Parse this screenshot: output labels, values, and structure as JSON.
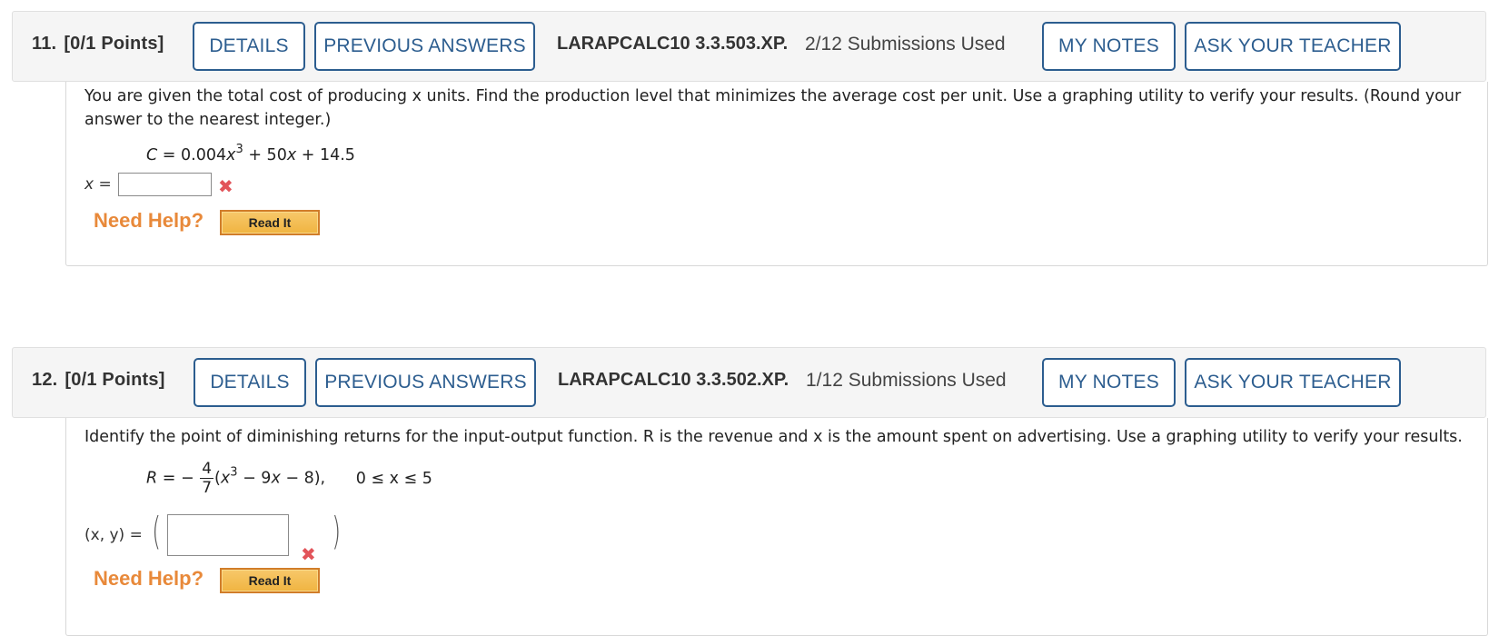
{
  "questions": [
    {
      "number": "11.",
      "points": "[0/1 Points]",
      "details_label": "DETAILS",
      "previous_answers_label": "PREVIOUS ANSWERS",
      "code": "LARAPCALC10 3.3.503.XP.",
      "submissions": "2/12 Submissions Used",
      "my_notes_label": "MY NOTES",
      "ask_teacher_label": "ASK YOUR TEACHER",
      "prompt": "You are given the total cost of producing x units. Find the production level that minimizes the average cost per unit. Use a graphing utility to verify your results. (Round your answer to the nearest integer.)",
      "equation": {
        "lhs": "C",
        "eq": " = 0.004",
        "var": "x",
        "exp": "3",
        "rest": " + 50",
        "var2": "x",
        "tail": " + 14.5"
      },
      "answer_label": "x =",
      "answer_value": "",
      "status": "incorrect",
      "need_help_label": "Need Help?",
      "read_it_label": "Read It"
    },
    {
      "number": "12.",
      "points": "[0/1 Points]",
      "details_label": "DETAILS",
      "previous_answers_label": "PREVIOUS ANSWERS",
      "code": "LARAPCALC10 3.3.502.XP.",
      "submissions": "1/12 Submissions Used",
      "my_notes_label": "MY NOTES",
      "ask_teacher_label": "ASK YOUR TEACHER",
      "prompt": "Identify the point of diminishing returns for the input-output function. R is the revenue and x is the amount spent on advertising. Use a graphing utility to verify your results.",
      "equation": {
        "lhs": "R",
        "eq": " = −",
        "frac_num": "4",
        "frac_den": "7",
        "open": "(",
        "var": "x",
        "exp": "3",
        "rest": " − 9",
        "var2": "x",
        "tail": " − 8),",
        "domain": "0 ≤ x ≤ 5"
      },
      "answer_label": "(x, y) =",
      "answer_value": "",
      "status": "incorrect",
      "need_help_label": "Need Help?",
      "read_it_label": "Read It"
    }
  ],
  "icons": {
    "incorrect": "✖"
  },
  "colors": {
    "accent": "#2c5d8f",
    "incorrect": "#e2545a",
    "help": "#e8893a"
  }
}
